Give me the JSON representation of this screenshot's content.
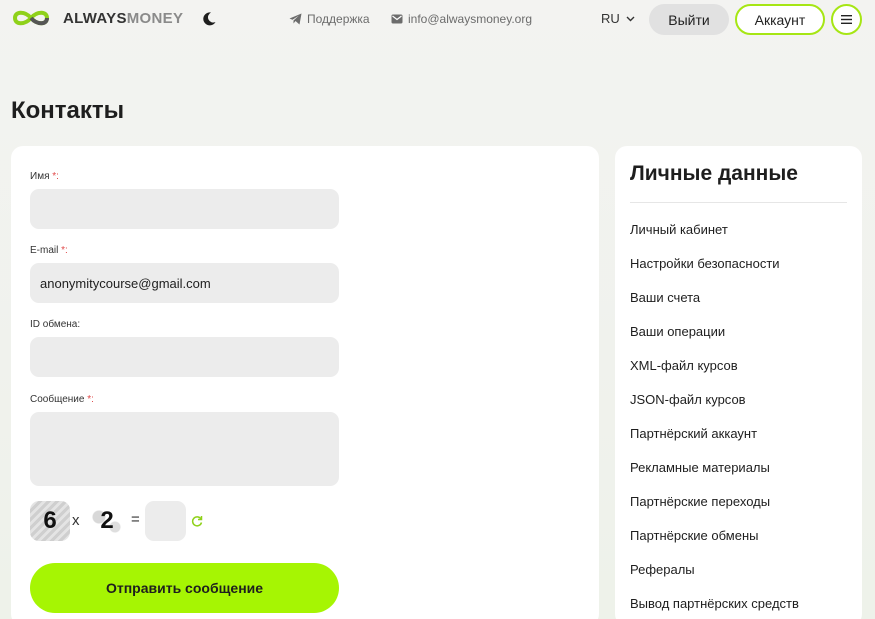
{
  "header": {
    "logo": {
      "text_bold": "ALWAYS",
      "text_light": "MONEY",
      "icon": "infinity-logo-icon"
    },
    "theme_icon": "moon-icon",
    "support": {
      "label": "Поддержка",
      "icon": "telegram-icon"
    },
    "email": {
      "label": "info@alwaysmoney.org",
      "icon": "mail-icon"
    },
    "language": {
      "label": "RU",
      "icon": "chevron-down-icon"
    },
    "logout_label": "Выйти",
    "account_label": "Аккаунт",
    "menu_icon": "hamburger-icon"
  },
  "page": {
    "title": "Контакты"
  },
  "form": {
    "name": {
      "label": "Имя",
      "required_mark": "*:",
      "value": ""
    },
    "email": {
      "label": "E-mail",
      "required_mark": "*:",
      "value": "anonymitycourse@gmail.com"
    },
    "exchange_id": {
      "label": "ID обмена:",
      "value": ""
    },
    "message": {
      "label": "Сообщение",
      "required_mark": "*:",
      "value": ""
    },
    "captcha": {
      "a": "6",
      "op": "x",
      "b": "2",
      "eq": "=",
      "answer": ""
    },
    "submit_label": "Отправить сообщение"
  },
  "sidebar": {
    "title": "Личные данные",
    "items": [
      {
        "label": "Личный кабинет"
      },
      {
        "label": "Настройки безопасности"
      },
      {
        "label": "Ваши счета"
      },
      {
        "label": "Ваши операции"
      },
      {
        "label": "XML-файл курсов"
      },
      {
        "label": "JSON-файл курсов"
      },
      {
        "label": "Партнёрский аккаунт"
      },
      {
        "label": "Рекламные материалы"
      },
      {
        "label": "Партнёрские переходы"
      },
      {
        "label": "Партнёрские обмены"
      },
      {
        "label": "Рефералы"
      },
      {
        "label": "Вывод партнёрских средств"
      }
    ]
  },
  "colors": {
    "accent": "#a6f503",
    "accent_border": "#a6e614",
    "required": "#e04848",
    "input_bg": "#ececec"
  }
}
